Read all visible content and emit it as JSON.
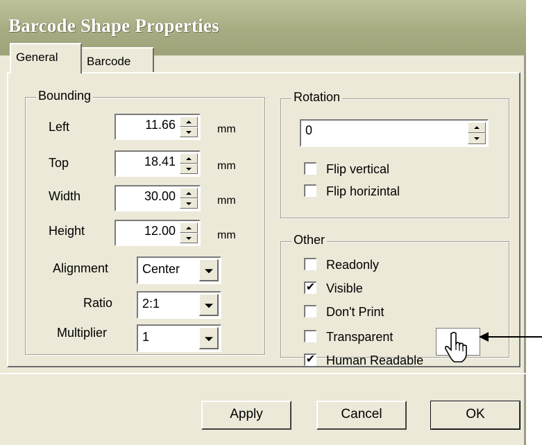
{
  "window": {
    "title": "Barcode Shape Properties"
  },
  "tabs": [
    {
      "label": "General"
    },
    {
      "label": "Barcode"
    }
  ],
  "bounding": {
    "legend": "Bounding",
    "fields": [
      {
        "label": "Left",
        "value": "11.66",
        "unit": "mm"
      },
      {
        "label": "Top",
        "value": "18.41",
        "unit": "mm"
      },
      {
        "label": "Width",
        "value": "30.00",
        "unit": "mm"
      },
      {
        "label": "Height",
        "value": "12.00",
        "unit": "mm"
      }
    ],
    "alignment": {
      "label": "Alignment",
      "value": "Center"
    },
    "ratio": {
      "label": "Ratio",
      "value": "2:1"
    },
    "multiplier": {
      "label": "Multiplier",
      "value": "1"
    }
  },
  "rotation": {
    "legend": "Rotation",
    "value": "0",
    "flip_vertical": {
      "label": "Flip vertical",
      "checked": false
    },
    "flip_horizontal": {
      "label": "Flip horizintal",
      "checked": false
    }
  },
  "other": {
    "legend": "Other",
    "items": [
      {
        "label": "Readonly",
        "checked": false,
        "mark": ""
      },
      {
        "label": "Visible",
        "checked": true,
        "mark": "✔"
      },
      {
        "label": "Don't Print",
        "checked": false,
        "mark": ""
      },
      {
        "label": "Transparent",
        "checked": false,
        "mark": ""
      },
      {
        "label": "Human Readable",
        "checked": true,
        "mark": "✔"
      }
    ]
  },
  "buttons": {
    "apply": "Apply",
    "cancel": "Cancel",
    "ok": "OK"
  },
  "annotation": {
    "cursor": "hand-pointer-icon",
    "arrow_color": "#000000"
  }
}
